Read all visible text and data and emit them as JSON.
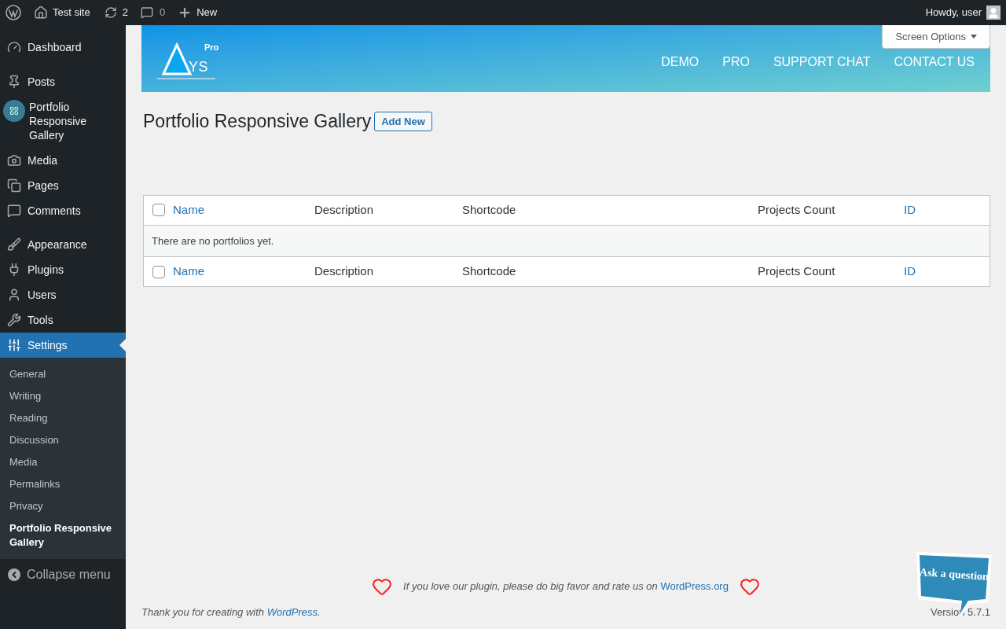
{
  "admin_bar": {
    "site": "Test site",
    "updates": "2",
    "comments": "0",
    "new": "New",
    "greeting": "Howdy, user"
  },
  "sidebar": {
    "groups": [
      [
        {
          "label": "Dashboard",
          "selected": false
        }
      ],
      [
        {
          "label": "Posts",
          "selected": false
        },
        {
          "label": "Portfolio Responsive Gallery",
          "selected": false
        },
        {
          "label": "Media",
          "selected": false
        },
        {
          "label": "Pages",
          "selected": false
        },
        {
          "label": "Comments",
          "selected": false
        }
      ],
      [
        {
          "label": "Appearance",
          "selected": false
        },
        {
          "label": "Plugins",
          "selected": false
        },
        {
          "label": "Users",
          "selected": false
        },
        {
          "label": "Tools",
          "selected": false
        },
        {
          "label": "Settings",
          "selected": true
        }
      ]
    ],
    "submenu": [
      {
        "label": "General",
        "selected": false
      },
      {
        "label": "Writing",
        "selected": false
      },
      {
        "label": "Reading",
        "selected": false
      },
      {
        "label": "Discussion",
        "selected": false
      },
      {
        "label": "Media",
        "selected": false
      },
      {
        "label": "Permalinks",
        "selected": false
      },
      {
        "label": "Privacy",
        "selected": false
      },
      {
        "label": "Portfolio Responsive Gallery",
        "selected": true
      }
    ],
    "collapse": "Collapse menu"
  },
  "banner": {
    "logo_badge": "Pro",
    "logo_text": "YS",
    "links": [
      "DEMO",
      "PRO",
      "SUPPORT CHAT",
      "CONTACT US"
    ]
  },
  "screen_options": "Screen Options",
  "page": {
    "title": "Portfolio Responsive Gallery",
    "add_new": "Add New"
  },
  "table": {
    "header": {
      "checked": false,
      "columns": [
        {
          "label": "Name",
          "sortable": true
        },
        {
          "label": "Description",
          "sortable": false
        },
        {
          "label": "Shortcode",
          "sortable": false
        },
        {
          "label": "Projects Count",
          "sortable": false
        },
        {
          "label": "ID",
          "sortable": true
        }
      ]
    },
    "empty_message": "There are no portfolios yet.",
    "footer": {
      "checked": false,
      "columns": [
        {
          "label": "Name",
          "sortable": true
        },
        {
          "label": "Description",
          "sortable": false
        },
        {
          "label": "Shortcode",
          "sortable": false
        },
        {
          "label": "Projects Count",
          "sortable": false
        },
        {
          "label": "ID",
          "sortable": true
        }
      ]
    }
  },
  "rate_note": {
    "text": "If you love our plugin, please do big favor and rate us on",
    "link": "WordPress.org"
  },
  "footer": {
    "text": "Thank you for creating with",
    "link": "WordPress",
    "after": ".",
    "version": "Version 5.7.1"
  },
  "help_bubble": "Ask a question"
}
